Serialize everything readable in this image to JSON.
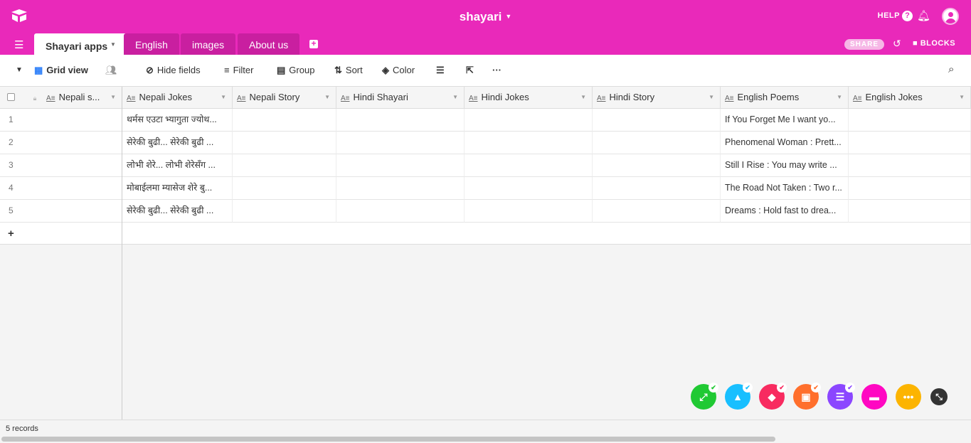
{
  "header": {
    "title": "shayari",
    "help": "HELP",
    "help_icon": "?",
    "share": "SHARE",
    "blocks": "BLOCKS"
  },
  "tabs": [
    {
      "label": "Shayari apps"
    },
    {
      "label": "English"
    },
    {
      "label": "images"
    },
    {
      "label": "About us"
    }
  ],
  "toolbar": {
    "view": "Grid view",
    "hide_fields": "Hide fields",
    "filter": "Filter",
    "group": "Group",
    "sort": "Sort",
    "color": "Color"
  },
  "columns": [
    "Nepali s...",
    "Nepali Jokes",
    "Nepali Story",
    "Hindi Shayari",
    "Hindi Jokes",
    "Hindi Story",
    "English Poems",
    "English Jokes"
  ],
  "rows": [
    {
      "n": "1",
      "nepali_jokes": "थर्मस एउटा भ्यागुता ज्योथ...",
      "english_poems": "If You Forget Me I want yo..."
    },
    {
      "n": "2",
      "nepali_jokes": "सेरेकी बुढी... सेरेकी बुढी ...",
      "english_poems": "Phenomenal Woman : Prett..."
    },
    {
      "n": "3",
      "nepali_jokes": "लोभी शेरे... लोभी शेरेसँग ...",
      "english_poems": "Still I Rise : You may write ..."
    },
    {
      "n": "4",
      "nepali_jokes": "मोबाईलमा म्यासेज शेरे बु...",
      "english_poems": "The Road Not Taken : Two r..."
    },
    {
      "n": "5",
      "nepali_jokes": "सेरेकी बुढी... सेरेकी बुढी ...",
      "english_poems": "Dreams : Hold fast to drea..."
    }
  ],
  "add_row": "+",
  "footer": {
    "records": "5 records"
  },
  "colors": {
    "brand": "#e929ba",
    "blocks": [
      "#20c933",
      "#18bfff",
      "#f82b60",
      "#ff6f2c",
      "#8b46ff",
      "#ff08c2",
      "#fcb400",
      "#333333"
    ]
  }
}
